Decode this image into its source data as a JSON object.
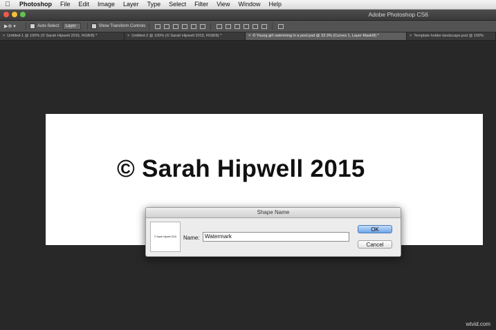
{
  "menubar": {
    "app_name": "Photoshop",
    "items": [
      "File",
      "Edit",
      "Image",
      "Layer",
      "Type",
      "Select",
      "Filter",
      "View",
      "Window",
      "Help"
    ]
  },
  "window": {
    "title": "Adobe Photoshop CS6",
    "traffic_colors": {
      "close": "#ee5b4e",
      "minimize": "#f4bd3a",
      "zoom": "#60c44c"
    }
  },
  "options_bar": {
    "auto_select_label": "Auto-Select:",
    "auto_select_value": "Layer",
    "show_transform_label": "Show Transform Controls"
  },
  "tabs": [
    {
      "label": "Untitled-1 @ 100% (© Sarah Hipwell 2015, RGB/8) *",
      "active": false
    },
    {
      "label": "Untitled-2 @ 100% (© Sarah Hipwell 2015, RGB/8) *",
      "active": false
    },
    {
      "label": "© Young girl swimming in a pool.psd @ 33.3% (Curves 1, Layer Mask/8) *",
      "active": true
    },
    {
      "label": "Template holder-landscape.psd @ 100%",
      "active": false
    }
  ],
  "canvas": {
    "text": "© Sarah Hipwell 2015"
  },
  "dialog": {
    "title": "Shape Name",
    "preview_text": "© Sarah Hipwell 2015",
    "name_label": "Name:",
    "name_value": "Watermark",
    "ok_label": "OK",
    "cancel_label": "Cancel"
  },
  "watermark_text": "wtvid.com",
  "colors": {
    "workspace_bg": "#282828",
    "ok_button": "#6ea5ea"
  }
}
